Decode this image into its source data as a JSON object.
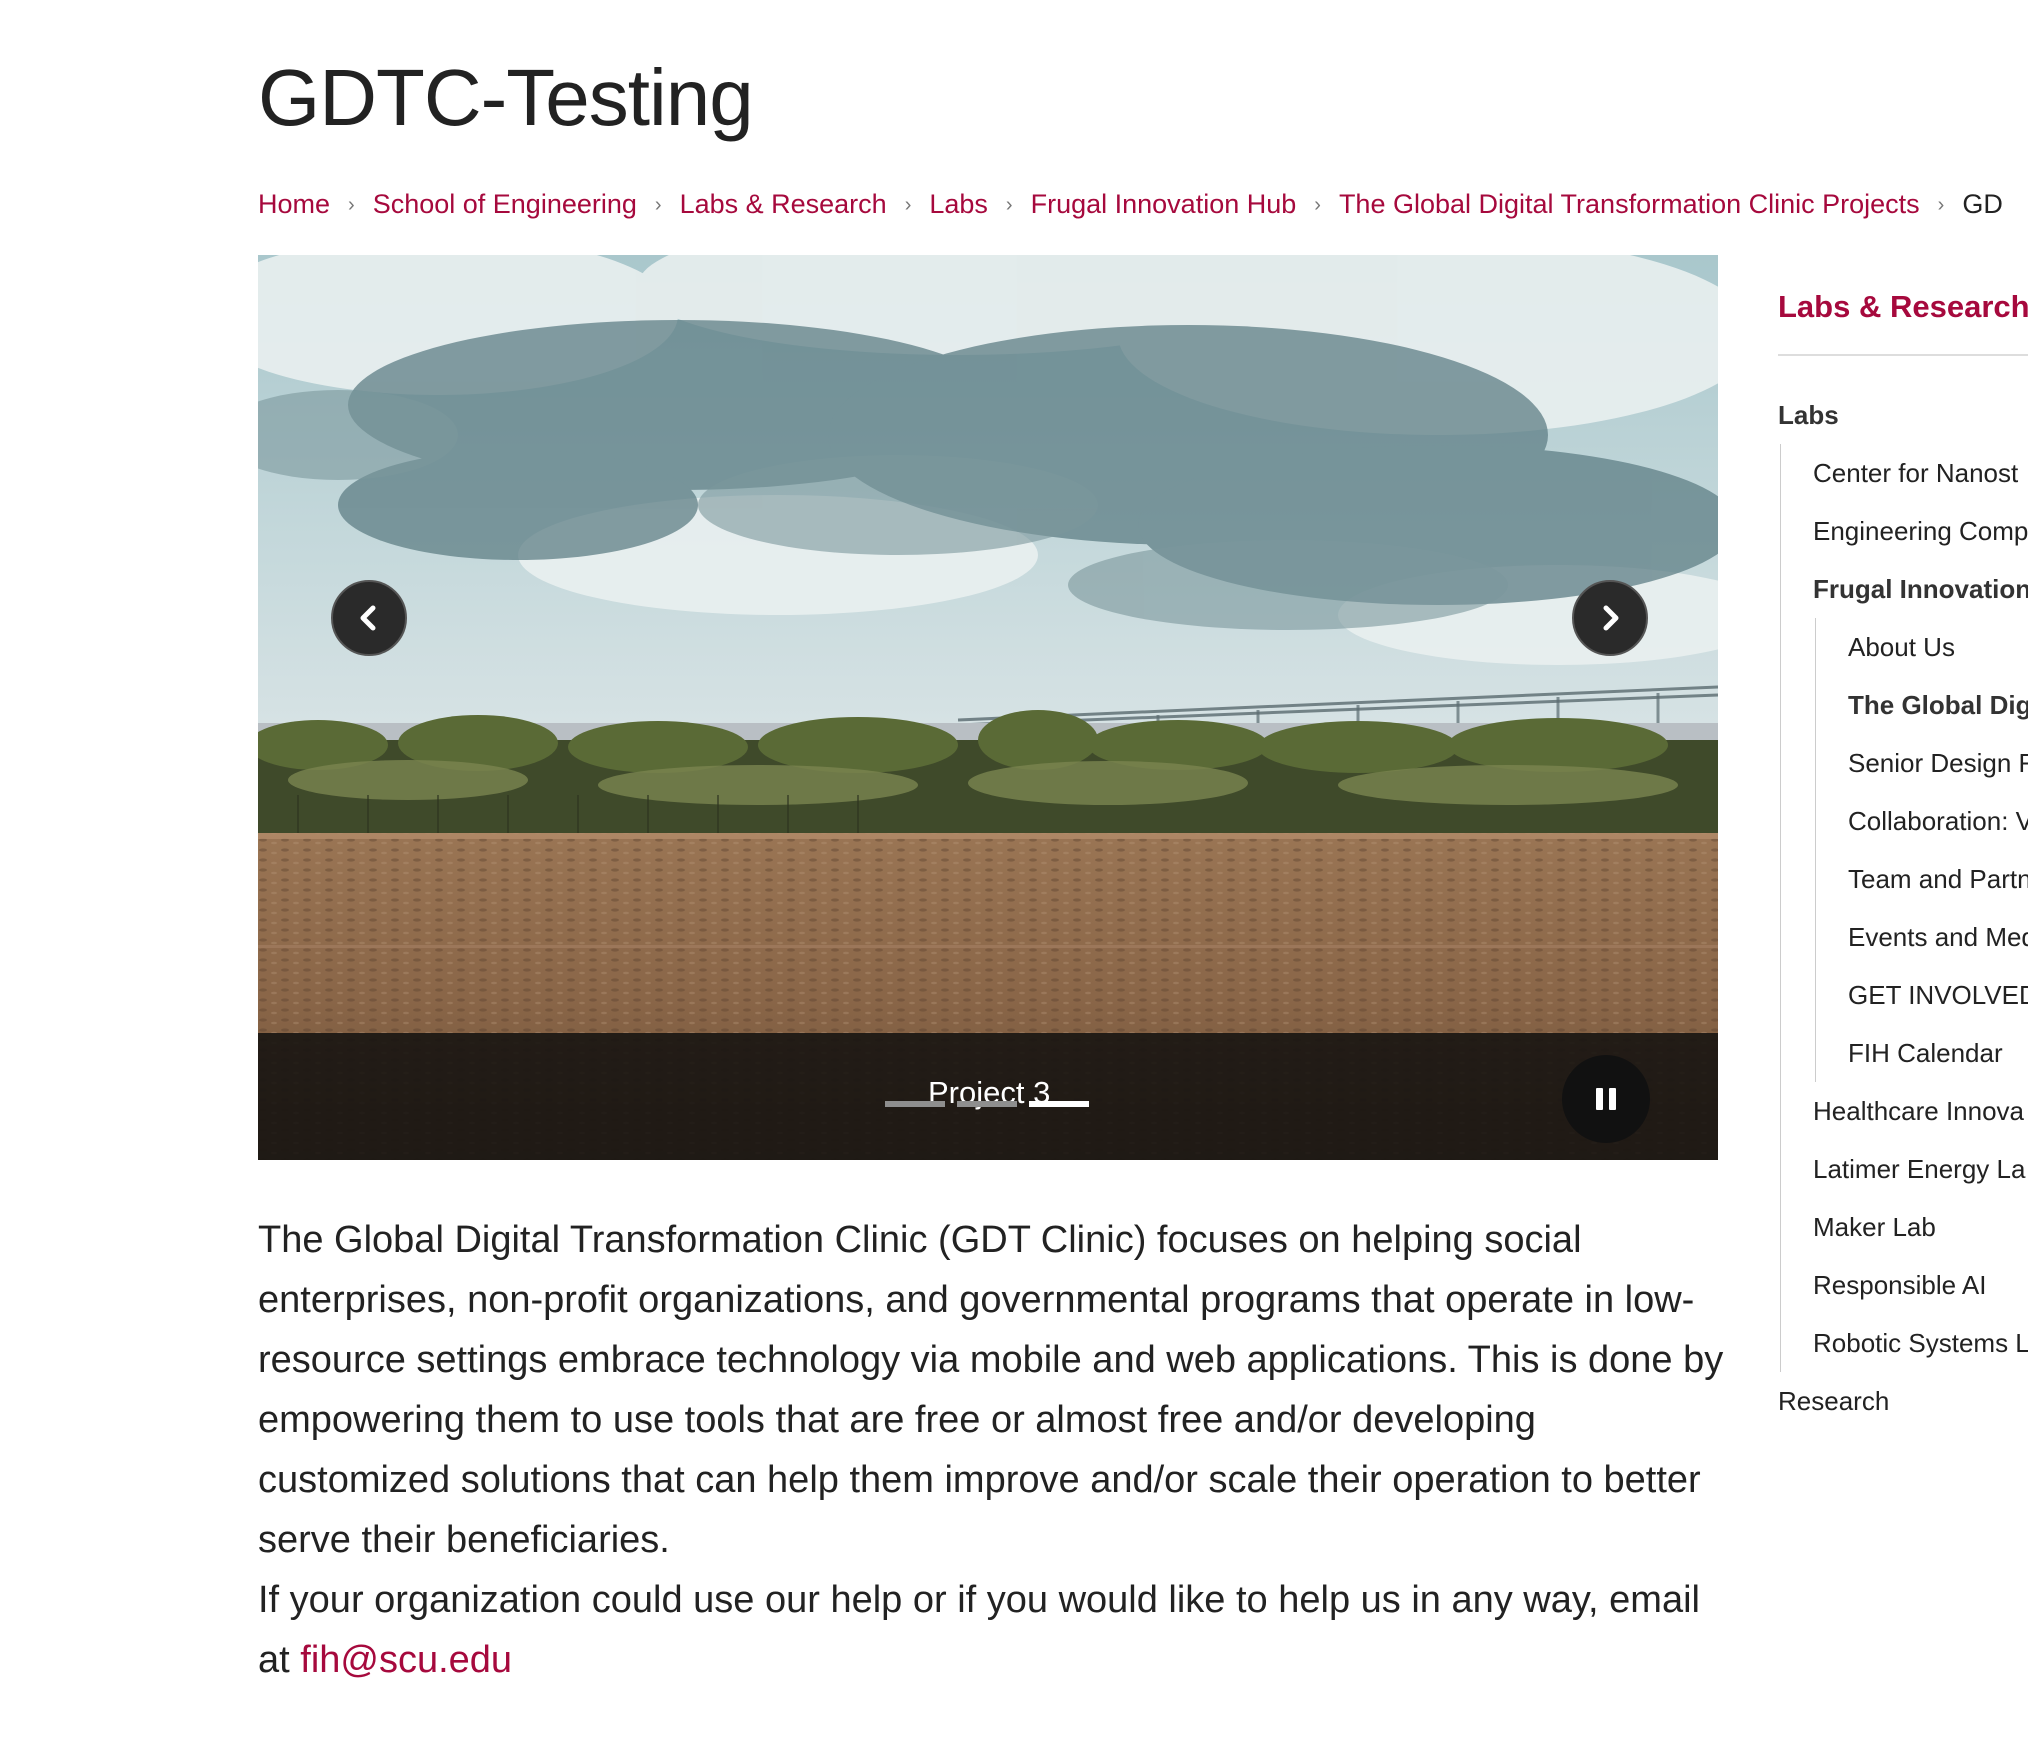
{
  "page": {
    "title": "GDTC-Testing"
  },
  "breadcrumb": {
    "items": [
      "Home",
      "School of Engineering",
      "Labs & Research",
      "Labs",
      "Frugal Innovation Hub",
      "The Global Digital Transformation Clinic Projects"
    ],
    "current": "GD",
    "separator": "›"
  },
  "slider": {
    "caption": "Project 3",
    "prev_icon": "chevron-left-icon",
    "next_icon": "chevron-right-icon",
    "pause_icon": "pause-icon",
    "slide_count": 3,
    "active_slide": 3
  },
  "content": {
    "paragraph1": "The Global Digital Transformation Clinic (GDT Clinic) focuses on helping social enterprises, non-profit organizations, and governmental programs that operate in low-resource settings embrace technology via mobile and web applications. This is done by empowering them to use tools that are free or almost free and/or developing customized solutions that can help them improve and/or scale their operation to better serve their beneficiaries.",
    "paragraph2_prefix": "If your organization could use our help or if you would like to help us in any way, email at",
    "email": "fih@scu.edu"
  },
  "sidebar": {
    "heading": "Labs & Research",
    "labs_label": "Labs",
    "labs_items": [
      "Center for Nanost",
      "Engineering Comp",
      "Frugal Innovation",
      "Healthcare Innova",
      "Latimer Energy La",
      "Maker Lab",
      "Responsible AI",
      "Robotic Systems L"
    ],
    "fih_items": [
      "About Us",
      "The Global Dig",
      "Senior Design F",
      "Collaboration: V",
      "Team and Partn",
      "Events and Med",
      "GET INVOLVED",
      "FIH Calendar"
    ],
    "research_label": "Research"
  },
  "colors": {
    "accent": "#a6093d",
    "text": "#222222"
  }
}
